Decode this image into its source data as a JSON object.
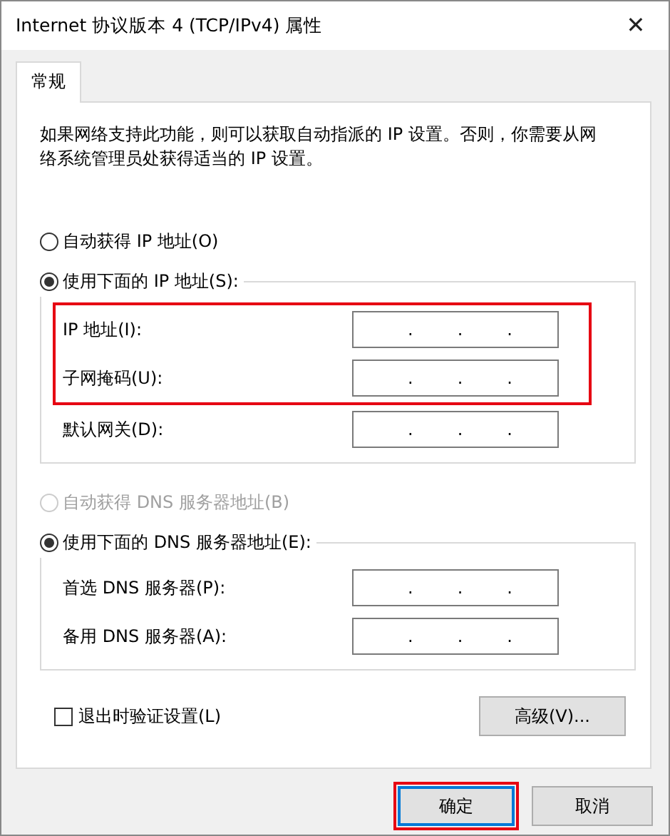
{
  "window": {
    "title": "Internet 协议版本 4 (TCP/IPv4) 属性",
    "close": "✕"
  },
  "tabs": [
    {
      "label": "常规",
      "selected": true
    }
  ],
  "description": "如果网络支持此功能，则可以获取自动指派的 IP 设置。否则，你需要从网络系统管理员处获得适当的 IP 设置。",
  "ip_section": {
    "auto_option": {
      "label": "自动获得 IP 地址(O)",
      "selected": false,
      "disabled": false
    },
    "manual_option": {
      "label": "使用下面的 IP 地址(S):",
      "selected": true,
      "disabled": false
    },
    "fields": [
      {
        "label": "IP 地址(I):",
        "separators": [
          ".",
          ".",
          "."
        ],
        "highlighted": true
      },
      {
        "label": "子网掩码(U):",
        "separators": [
          ".",
          ".",
          "."
        ],
        "highlighted": true
      },
      {
        "label": "默认网关(D):",
        "separators": [
          ".",
          ".",
          "."
        ],
        "highlighted": false
      }
    ]
  },
  "dns_section": {
    "auto_option": {
      "label": "自动获得 DNS 服务器地址(B)",
      "selected": false,
      "disabled": true
    },
    "manual_option": {
      "label": "使用下面的 DNS 服务器地址(E):",
      "selected": true,
      "disabled": false
    },
    "fields": [
      {
        "label": "首选 DNS 服务器(P):",
        "separators": [
          ".",
          ".",
          "."
        ],
        "highlighted": false
      },
      {
        "label": "备用 DNS 服务器(A):",
        "separators": [
          ".",
          ".",
          "."
        ],
        "highlighted": false
      }
    ]
  },
  "validate_checkbox": {
    "label": "退出时验证设置(L)",
    "checked": false
  },
  "advanced_button": "高级(V)...",
  "buttons": [
    {
      "label": "确定",
      "default": true,
      "highlighted": true
    },
    {
      "label": "取消",
      "default": false,
      "highlighted": false
    }
  ]
}
